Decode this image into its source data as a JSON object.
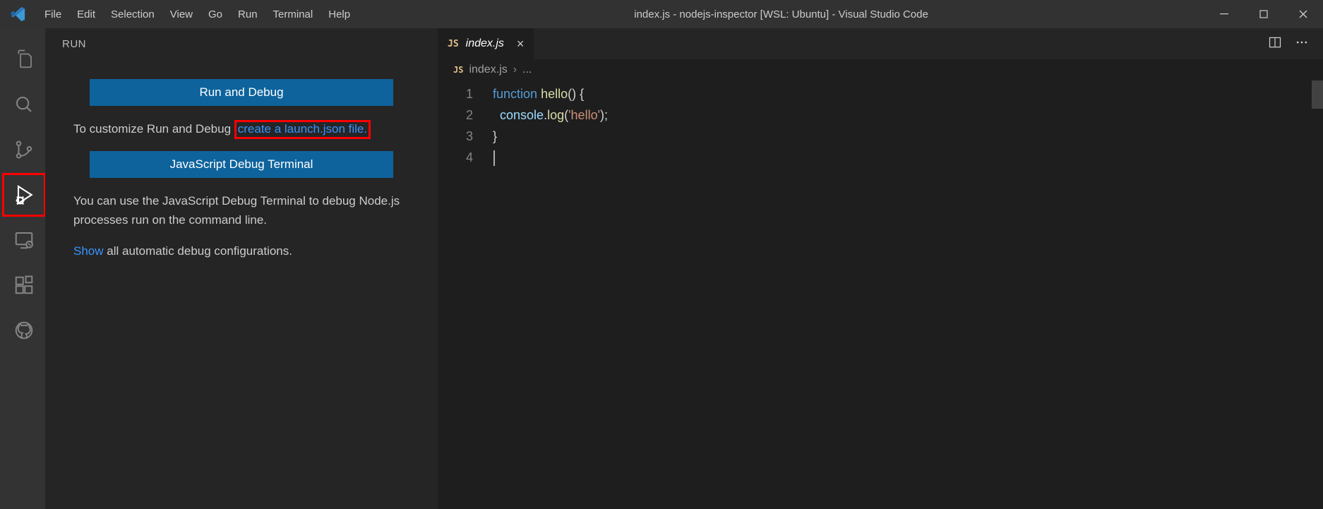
{
  "title": "index.js - nodejs-inspector [WSL: Ubuntu] - Visual Studio Code",
  "menu": [
    "File",
    "Edit",
    "Selection",
    "View",
    "Go",
    "Run",
    "Terminal",
    "Help"
  ],
  "sidebar": {
    "header": "RUN",
    "run_debug_btn": "Run and Debug",
    "customize_pre": "To customize Run and Debug ",
    "customize_link": "create a launch.json file.",
    "js_terminal_btn": "JavaScript Debug Terminal",
    "js_terminal_desc": "You can use the JavaScript Debug Terminal to debug Node.js processes run on the command line.",
    "show_link": "Show",
    "show_rest": " all automatic debug configurations."
  },
  "tab": {
    "badge": "JS",
    "name": "index.js"
  },
  "breadcrumb": {
    "badge": "JS",
    "file": "index.js",
    "sep": "›",
    "tail": "..."
  },
  "code": {
    "lines": [
      "1",
      "2",
      "3",
      "4"
    ],
    "l1_kw": "function",
    "l1_fn": "hello",
    "l1_rest": "() {",
    "l2_obj": "console",
    "l2_dot": ".",
    "l2_fn": "log",
    "l2_paren_open": "(",
    "l2_str": "'hello'",
    "l2_paren_close": ");",
    "l3": "}",
    "l4": ""
  }
}
